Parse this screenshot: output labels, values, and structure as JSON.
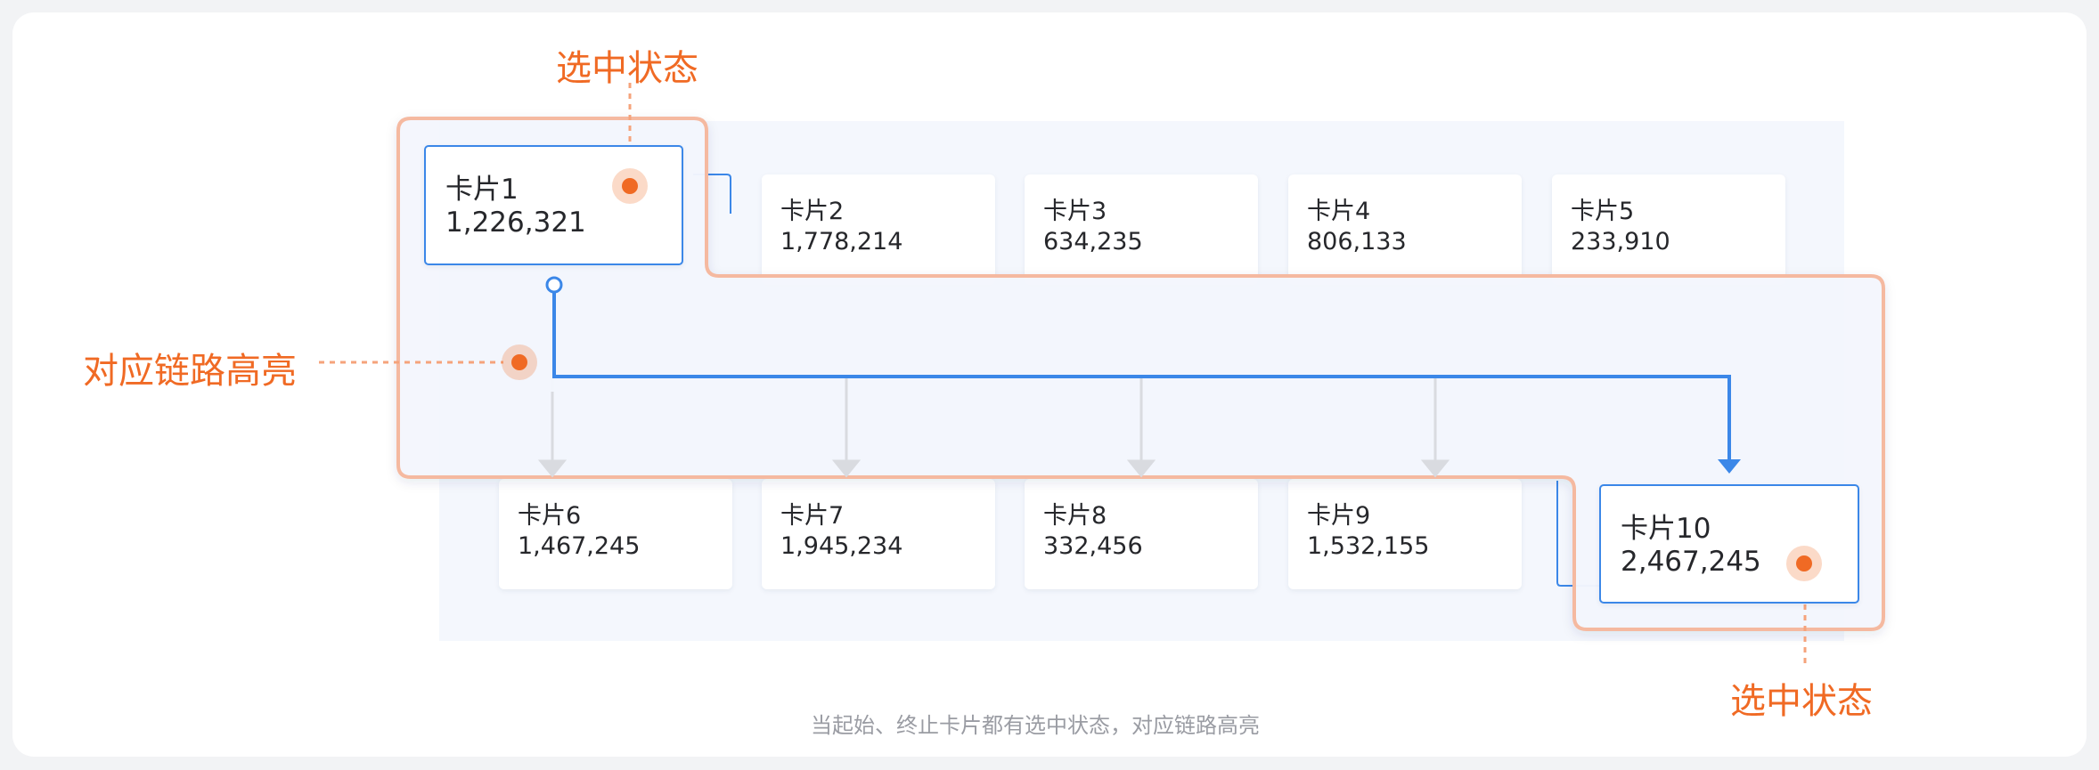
{
  "cards": {
    "c1": {
      "name": "卡片1",
      "value": "1,226,321"
    },
    "c2": {
      "name": "卡片2",
      "value": "1,778,214"
    },
    "c3": {
      "name": "卡片3",
      "value": "634,235"
    },
    "c4": {
      "name": "卡片4",
      "value": "806,133"
    },
    "c5": {
      "name": "卡片5",
      "value": "233,910"
    },
    "c6": {
      "name": "卡片6",
      "value": "1,467,245"
    },
    "c7": {
      "name": "卡片7",
      "value": "1,945,234"
    },
    "c8": {
      "name": "卡片8",
      "value": "332,456"
    },
    "c9": {
      "name": "卡片9",
      "value": "1,532,155"
    },
    "c10": {
      "name": "卡片10",
      "value": "2,467,245"
    }
  },
  "annotations": {
    "top_selected": "选中状态",
    "bottom_selected": "选中状态",
    "link_highlight": "对应链路高亮"
  },
  "caption": "当起始、终止卡片都有选中状态，对应链路高亮",
  "colors": {
    "accent_blue": "#3b87e8",
    "highlight_orange": "#f06a24",
    "highlight_border": "#f5b9a0",
    "panel_bg": "#f4f7fd",
    "arrow_gray": "#d9dbe0"
  }
}
